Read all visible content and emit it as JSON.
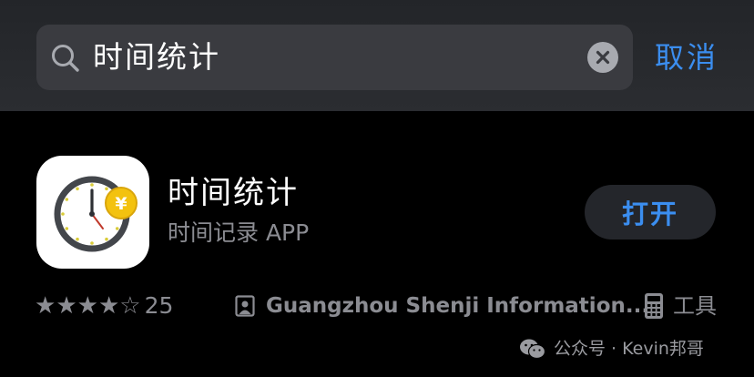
{
  "search": {
    "query": "时间统计",
    "cancel_label": "取消"
  },
  "app": {
    "name": "时间统计",
    "subtitle": "时间记录 APP",
    "open_label": "打开",
    "icon_currency_symbol": "¥",
    "rating_stars": 4,
    "rating_max": 5,
    "rating_count": "25",
    "developer": "Guangzhou Shenji Information...",
    "category": "工具"
  },
  "watermark": {
    "text": "公众号 · Kevin邦哥"
  },
  "colors": {
    "accent": "#3b8ef0",
    "secondary_text": "#8b8c92",
    "background": "#000000",
    "search_bar": "#3a3b40"
  }
}
